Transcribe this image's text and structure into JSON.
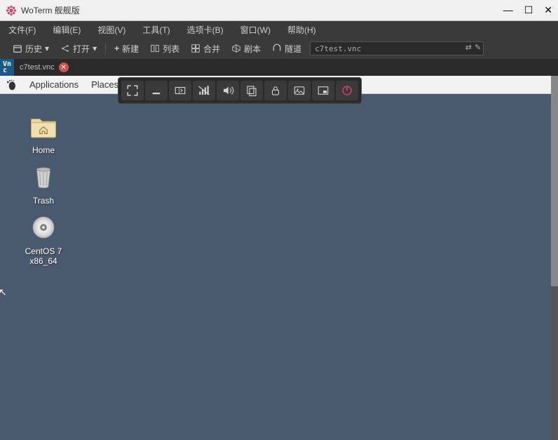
{
  "window": {
    "title": "WoTerm 舰舰版"
  },
  "menubar": {
    "file": "文件(F)",
    "edit": "编辑(E)",
    "view": "视图(V)",
    "tools": "工具(T)",
    "tabs": "选项卡(B)",
    "window": "窗口(W)",
    "help": "帮助(H)"
  },
  "toolbar": {
    "history": "历史",
    "open": "打开",
    "new": "新建",
    "list": "列表",
    "merge": "合并",
    "script": "剧本",
    "tunnel": "隧道",
    "search_value": "c7test.vnc"
  },
  "tabs": {
    "vnc_label": "Vn\nc",
    "tab1": "c7test.vnc"
  },
  "gnome": {
    "applications": "Applications",
    "places": "Places"
  },
  "desktop": {
    "home": "Home",
    "trash": "Trash",
    "centos": "CentOS 7\nx86_64"
  }
}
